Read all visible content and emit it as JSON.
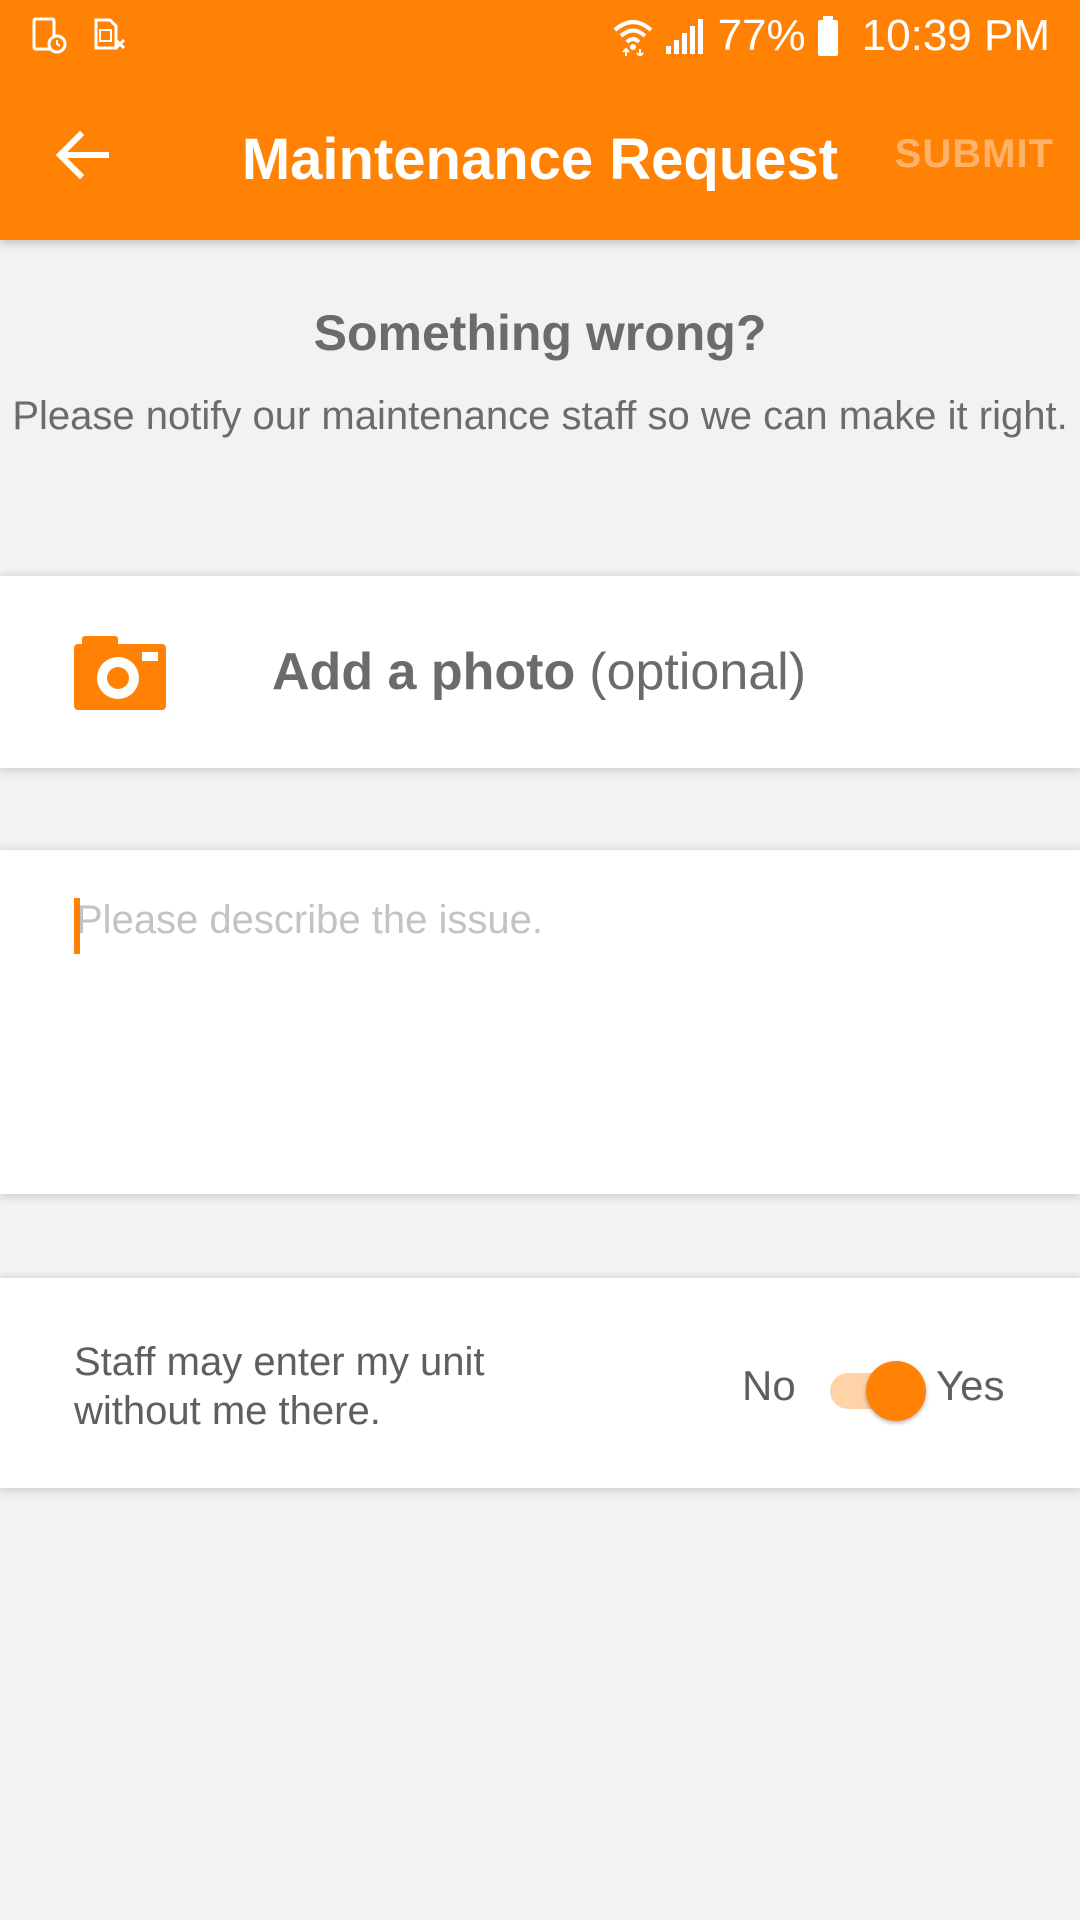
{
  "colors": {
    "accent": "#FF8205",
    "background": "#F2F2F2",
    "submit_disabled": "#FFB36A"
  },
  "status_bar": {
    "left_icons": [
      "screenshot-notification-icon",
      "sim-card-icon"
    ],
    "right_icons": [
      "wifi-icon",
      "signal-icon",
      "battery-icon"
    ],
    "battery": "77%",
    "time": "10:39 PM"
  },
  "toolbar": {
    "back_icon": "arrow-left-icon",
    "title": "Maintenance Request",
    "submit_label": "SUBMIT"
  },
  "intro": {
    "heading": "Something wrong?",
    "text": "Please notify our maintenance staff so we can make it right."
  },
  "photo": {
    "icon": "camera-icon",
    "label_bold": "Add a photo",
    "label_light": "(optional)"
  },
  "describe": {
    "placeholder": "Please describe the issue.",
    "value": ""
  },
  "permission": {
    "text": "Staff may enter my unit without me there.",
    "no_label": "No",
    "yes_label": "Yes",
    "enabled": true
  }
}
